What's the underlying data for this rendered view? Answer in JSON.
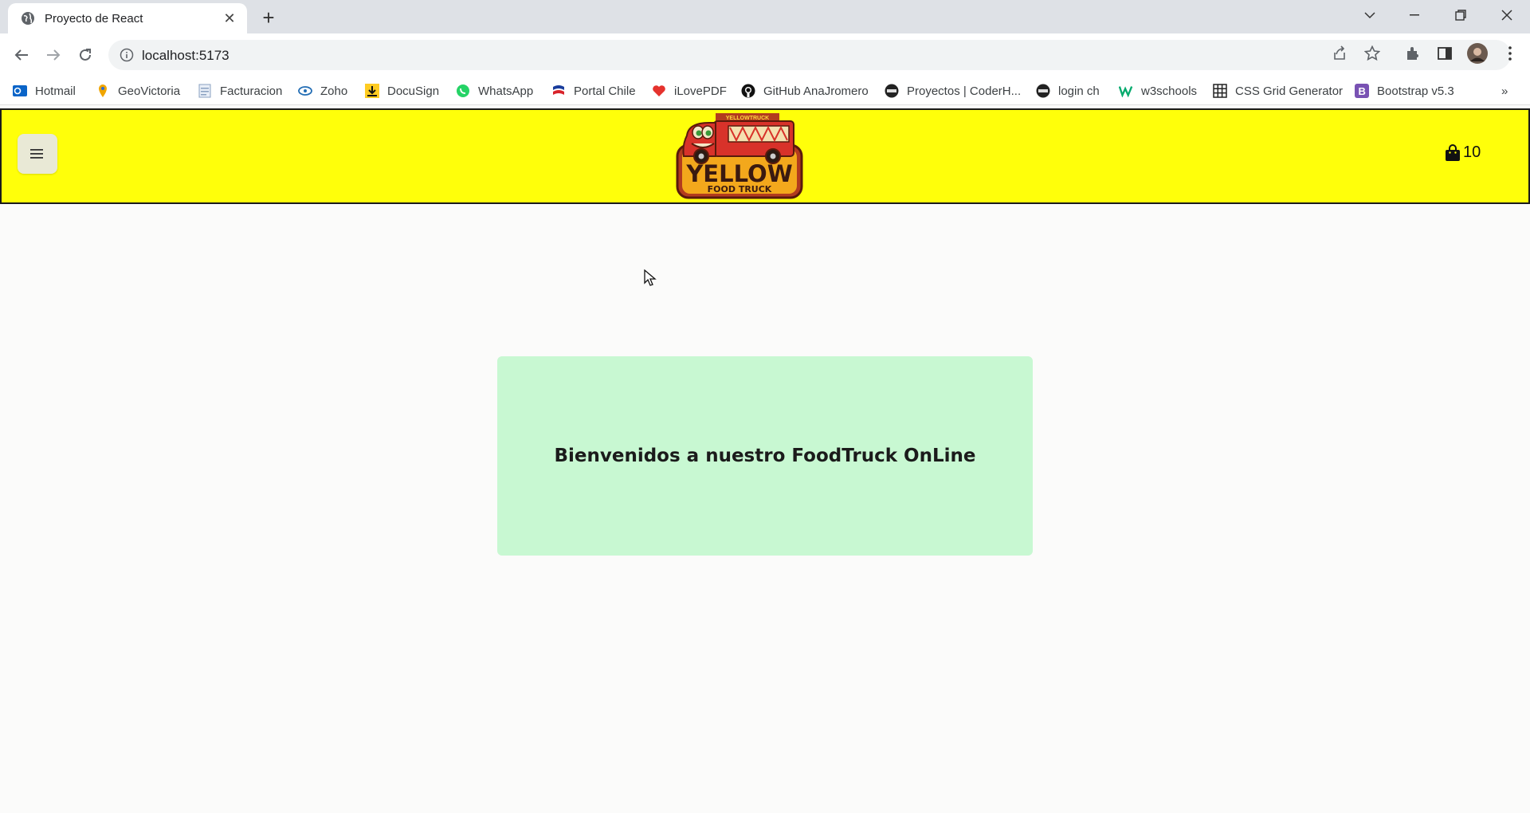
{
  "browser": {
    "tab_title": "Proyecto de React",
    "url": "localhost:5173",
    "bookmarks": [
      {
        "label": "Hotmail",
        "icon": "outlook-icon"
      },
      {
        "label": "GeoVictoria",
        "icon": "map-pin-icon"
      },
      {
        "label": "Facturacion",
        "icon": "document-icon"
      },
      {
        "label": "Zoho",
        "icon": "zoho-icon"
      },
      {
        "label": "DocuSign",
        "icon": "docusign-icon"
      },
      {
        "label": "WhatsApp",
        "icon": "whatsapp-icon"
      },
      {
        "label": "Portal Chile",
        "icon": "portal-chile-icon"
      },
      {
        "label": "iLovePDF",
        "icon": "heart-icon"
      },
      {
        "label": "GitHub AnaJromero",
        "icon": "github-icon"
      },
      {
        "label": "Proyectos | CoderH...",
        "icon": "coderhouse-icon"
      },
      {
        "label": "login ch",
        "icon": "coderhouse-icon"
      },
      {
        "label": "w3schools",
        "icon": "w3schools-icon"
      },
      {
        "label": "CSS Grid Generator",
        "icon": "grid-icon"
      },
      {
        "label": "Bootstrap v5.3",
        "icon": "bootstrap-icon"
      }
    ],
    "more_bookmarks": "»"
  },
  "app": {
    "logo": {
      "top_text": "YELLOWTRUCK",
      "main_text": "YELLOW",
      "sub_text": "FOOD TRUCK"
    },
    "cart_count": "10",
    "welcome_message": "Bienvenidos a nuestro FoodTruck OnLine"
  },
  "colors": {
    "appbar_bg": "#ffff0a",
    "welcome_bg": "#c8f8d2",
    "page_bg": "#fbfbfa"
  }
}
